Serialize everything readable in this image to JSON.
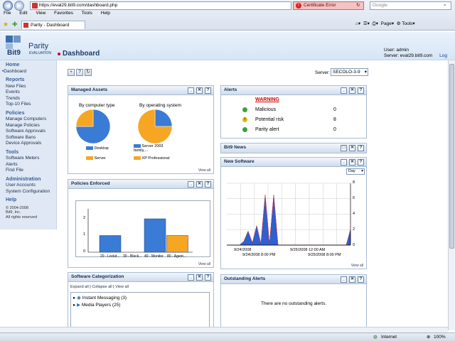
{
  "browser": {
    "url": "https://eval29.bit9.com/dashboard.php",
    "cert_error": "Certificate Error",
    "search_placeholder": "Google",
    "menu": [
      "File",
      "Edit",
      "View",
      "Favorites",
      "Tools",
      "Help"
    ],
    "tab_title": "Parity - Dashboard",
    "page_menu": "Page",
    "tools_menu": "Tools",
    "status_zone": "Internet",
    "zoom": "100%"
  },
  "logo": {
    "brand": "Bit9",
    "product": "Parity",
    "edition": "EVALUATION"
  },
  "header": {
    "title": "Dashboard",
    "user_label": "User:",
    "user_value": "admin",
    "server_label": "Server:",
    "server_value": "eval29.bit9.com",
    "logout": "Log"
  },
  "sidebar": {
    "sections": [
      {
        "title": "Home",
        "items": [
          "Dashboard"
        ]
      },
      {
        "title": "Reports",
        "items": [
          "New Files",
          "Events",
          "Trends",
          "Top-10 Files"
        ]
      },
      {
        "title": "Policies",
        "items": [
          "Manage Computers",
          "Manage Policies",
          "Software Approvals",
          "Software Bans",
          "Device Approvals"
        ]
      },
      {
        "title": "Tools",
        "items": [
          "Software Meters",
          "Alerts",
          "Find File"
        ]
      },
      {
        "title": "Administration",
        "items": [
          "User Accounts",
          "System Configuration"
        ]
      },
      {
        "title": "Help",
        "items": []
      }
    ],
    "copyright": [
      "© 2004-2008",
      "Bit9, Inc.",
      "All rights reserved"
    ]
  },
  "toolbar": {
    "server_label": "Server:",
    "server_value": "SECOLO-3-9"
  },
  "managed_assets": {
    "title": "Managed Assets",
    "by_type_label": "By computer type",
    "by_os_label": "By operating system",
    "type_legend": [
      "Desktop",
      "Server"
    ],
    "os_legend": [
      "Server 2003 family,...",
      "XP Professional"
    ],
    "view_all": "View all"
  },
  "alerts": {
    "title": "Alerts",
    "warning": "WARNING",
    "rows": [
      {
        "label": "Malicious",
        "count": "0"
      },
      {
        "label": "Potential risk",
        "count": "8"
      },
      {
        "label": "Parity alert",
        "count": "0"
      }
    ]
  },
  "bit9_news": {
    "title": "Bit9 News"
  },
  "new_software": {
    "title": "New Software",
    "period": "Day",
    "x_labels": [
      "9/24/2008",
      "9/24/2008 8:00 PM",
      "9/25/2008 12:00 AM",
      "9/25/2008 8:00 PM"
    ],
    "y_ticks": [
      "8",
      "6",
      "4",
      "2",
      "0"
    ],
    "view_all": "View all"
  },
  "policies_enforced": {
    "title": "Policies Enforced",
    "y_ticks": [
      "2",
      "1",
      "0"
    ],
    "x_labels": [
      "20 - Lockd...",
      "30 - Block...",
      "40 - Monitor",
      "80 - Agent..."
    ],
    "view_all": "View all"
  },
  "software_categorization": {
    "title": "Software Categorization",
    "links": [
      "Expand all",
      "Collapse all",
      "View all"
    ],
    "items": [
      "Instant Messaging (3)",
      "Media Players (25)"
    ]
  },
  "outstanding_alerts": {
    "title": "Outstanding Alerts",
    "message": "There are no outstanding alerts."
  },
  "chart_data": [
    {
      "type": "pie",
      "title": "By computer type",
      "categories": [
        "Desktop",
        "Server"
      ],
      "values": [
        75,
        25
      ],
      "colors": [
        "#3a7bd5",
        "#f6a623"
      ]
    },
    {
      "type": "pie",
      "title": "By operating system",
      "categories": [
        "Server 2003 family,...",
        "XP Professional"
      ],
      "values": [
        25,
        75
      ],
      "colors": [
        "#3a7bd5",
        "#f6a623"
      ]
    },
    {
      "type": "bar",
      "categories": [
        "20 - Lockd...",
        "30 - Block...",
        "40 - Monitor",
        "80 - Agent..."
      ],
      "values": [
        1,
        0,
        2,
        1
      ],
      "colors": [
        "#3a7bd5",
        "#3a7bd5",
        "#3a7bd5",
        "#f6a623"
      ],
      "ylim": [
        0,
        2
      ]
    },
    {
      "type": "area",
      "y2lim": [
        0,
        8
      ],
      "series": [
        {
          "values": [
            0,
            0,
            0,
            0,
            0.5,
            1.8,
            0.3,
            2.5,
            0.2,
            6.5,
            0.1,
            6.5,
            0,
            0,
            0,
            0,
            0,
            0,
            0,
            0,
            0,
            0,
            0,
            0,
            0,
            0,
            0,
            0,
            0,
            2
          ]
        }
      ]
    }
  ]
}
